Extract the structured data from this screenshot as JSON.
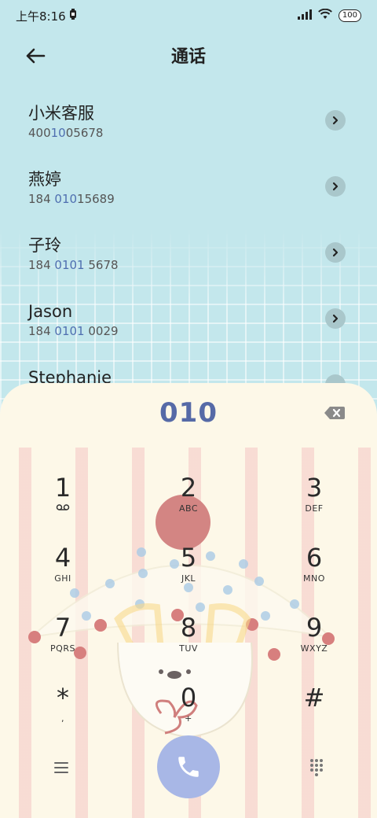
{
  "status_bar": {
    "time": "上午8:16",
    "battery": "100"
  },
  "header": {
    "title": "通话"
  },
  "contacts": [
    {
      "name": "小米客服",
      "number_pre": "400",
      "number_hl": "10",
      "number_post": "05678"
    },
    {
      "name": "燕婷",
      "number_pre": "184 ",
      "number_hl": "010",
      "number_post": "15689"
    },
    {
      "name": "子玲",
      "number_pre": "184 ",
      "number_hl": "0101",
      "number_post": " 5678"
    },
    {
      "name": "Jason",
      "number_pre": "184 ",
      "number_hl": "0101",
      "number_post": " 0029"
    },
    {
      "name": "Stephanie",
      "number_pre": "",
      "number_hl": "",
      "number_post": ""
    }
  ],
  "dialer": {
    "input": "010",
    "keys": [
      {
        "digit": "1",
        "letters": ""
      },
      {
        "digit": "2",
        "letters": "ABC"
      },
      {
        "digit": "3",
        "letters": "DEF"
      },
      {
        "digit": "4",
        "letters": "GHI"
      },
      {
        "digit": "5",
        "letters": "JKL"
      },
      {
        "digit": "6",
        "letters": "MNO"
      },
      {
        "digit": "7",
        "letters": "PQRS"
      },
      {
        "digit": "8",
        "letters": "TUV"
      },
      {
        "digit": "9",
        "letters": "WXYZ"
      },
      {
        "digit": "*",
        "letters": ","
      },
      {
        "digit": "0",
        "letters": "+"
      },
      {
        "digit": "#",
        "letters": ""
      }
    ]
  },
  "colors": {
    "background": "#c3e7ec",
    "panel": "#fdf8e8",
    "accent": "#566aa7",
    "call_button": "#a8b7e6"
  },
  "icons": {
    "back": "arrow-left-icon",
    "chevron": "chevron-right-icon",
    "delete": "backspace-icon",
    "call": "phone-icon",
    "menu": "menu-icon",
    "keypad": "dialpad-icon",
    "voicemail": "voicemail-icon"
  }
}
